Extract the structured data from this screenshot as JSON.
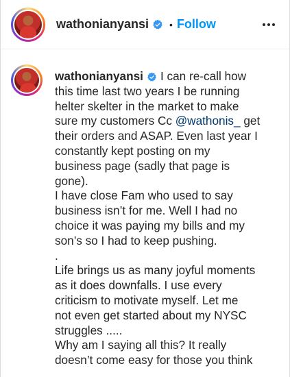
{
  "header": {
    "username": "wathonianyansi",
    "separator": "•",
    "follow_label": "Follow",
    "more_icon": "more-options-icon"
  },
  "caption": {
    "username": "wathonianyansi",
    "mention": "@wathonis_",
    "lines": [
      "I can re-call how",
      "this time last two years I be running",
      "helter skelter in the market to make",
      "sure my customers Cc ",
      " get",
      "their orders and ASAP. Even last year I",
      "constantly kept posting on my",
      "business page (sadly that page is",
      "gone).",
      "I have close Fam who used to say",
      "business isn’t for me. Well I had no",
      "choice it was paying my bills and my",
      "son’s so I had to keep pushing.",
      ".",
      "Life brings us as many joyful moments",
      "as it does downfalls. I use every",
      "criticism to motivate myself. Let me",
      "not even get started about my NYSC",
      "struggles .....",
      "Why am I saying all this? It really",
      "doesn’t come easy for those you think"
    ]
  },
  "colors": {
    "follow_blue": "#0095f6",
    "mention_blue": "#00376b",
    "verified_blue": "#3897f0",
    "text": "#262626"
  }
}
